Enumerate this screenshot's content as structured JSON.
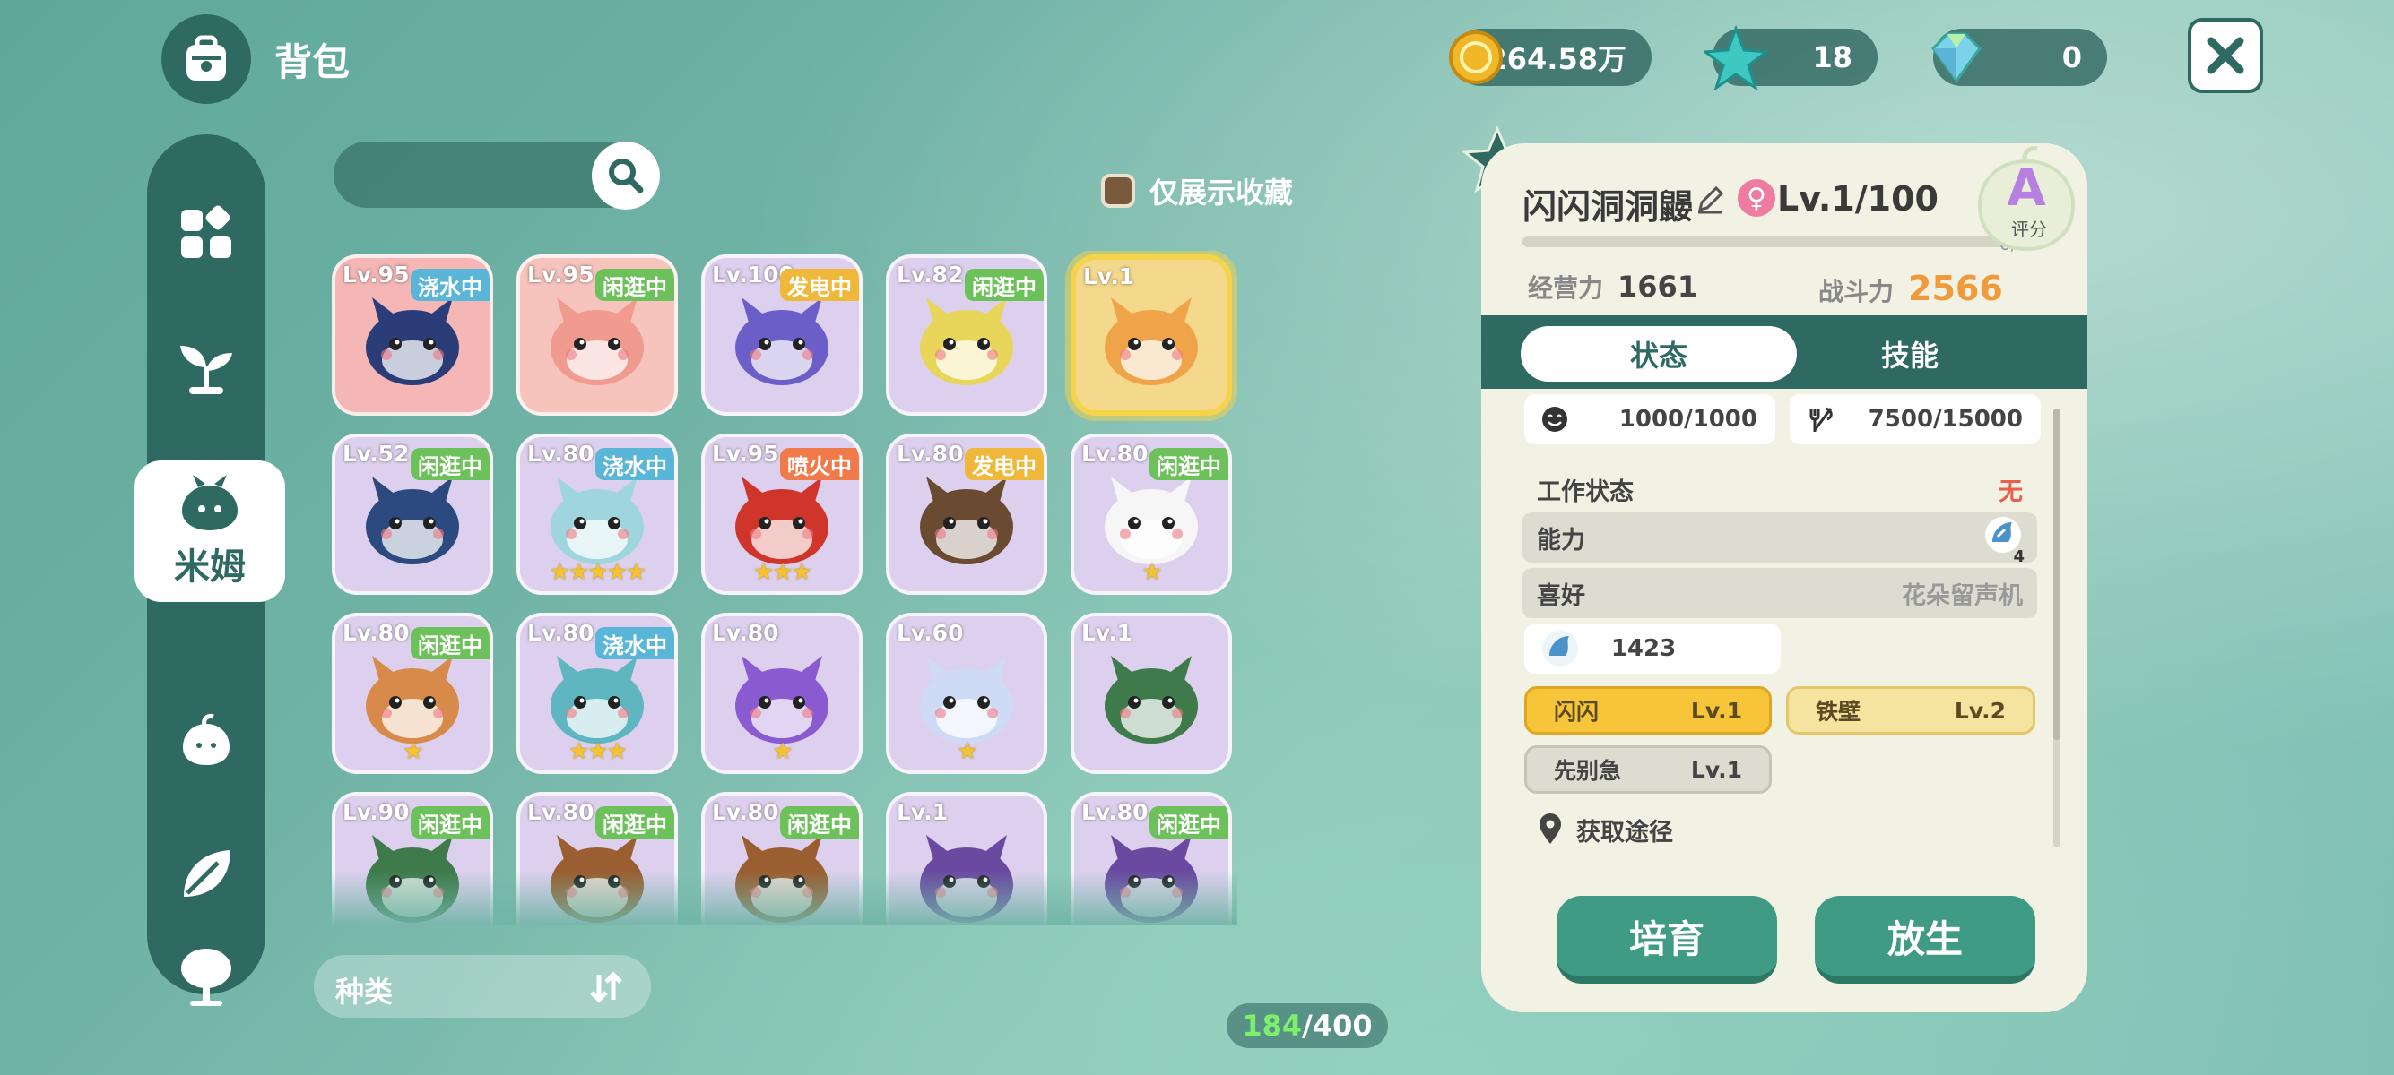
{
  "header": {
    "title": "背包"
  },
  "currencies": [
    {
      "name": "gold-coin",
      "value": "264.58万"
    },
    {
      "name": "star-crystal",
      "value": "18"
    },
    {
      "name": "gem",
      "value": "0"
    }
  ],
  "sidebar": {
    "active_label": "米姆"
  },
  "filter": {
    "favorites_label": "仅展示收藏"
  },
  "sort": {
    "label": "种类"
  },
  "inventory": {
    "count": "184",
    "capacity": "/400"
  },
  "creatures": [
    {
      "lv": "Lv.95",
      "status": "浇水中",
      "stars": ""
    },
    {
      "lv": "Lv.95",
      "status": "闲逛中",
      "stars": ""
    },
    {
      "lv": "Lv.100",
      "status": "发电中",
      "stars": ""
    },
    {
      "lv": "Lv.82",
      "status": "闲逛中",
      "stars": ""
    },
    {
      "lv": "Lv.1",
      "status": "",
      "stars": ""
    },
    {
      "lv": "Lv.52",
      "status": "闲逛中",
      "stars": ""
    },
    {
      "lv": "Lv.80",
      "status": "浇水中",
      "stars": "★★★★★"
    },
    {
      "lv": "Lv.95",
      "status": "喷火中",
      "stars": "★★★"
    },
    {
      "lv": "Lv.80",
      "status": "发电中",
      "stars": ""
    },
    {
      "lv": "Lv.80",
      "status": "闲逛中",
      "stars": "★"
    },
    {
      "lv": "Lv.80",
      "status": "闲逛中",
      "stars": "★"
    },
    {
      "lv": "Lv.80",
      "status": "浇水中",
      "stars": "★★★"
    },
    {
      "lv": "Lv.80",
      "status": "",
      "stars": "★"
    },
    {
      "lv": "Lv.60",
      "status": "",
      "stars": "★"
    },
    {
      "lv": "Lv.1",
      "status": "",
      "stars": ""
    },
    {
      "lv": "Lv.90",
      "status": "闲逛中",
      "stars": ""
    },
    {
      "lv": "Lv.80",
      "status": "闲逛中",
      "stars": ""
    },
    {
      "lv": "Lv.80",
      "status": "闲逛中",
      "stars": ""
    },
    {
      "lv": "Lv.1",
      "status": "",
      "stars": ""
    },
    {
      "lv": "Lv.80",
      "status": "闲逛中",
      "stars": ""
    }
  ],
  "detail": {
    "name": "闪闪洞洞鼹",
    "level": "Lv.1/100",
    "xp": "0/15",
    "rank": "A",
    "rank_label": "评分",
    "management_label": "经营力",
    "management_value": "1661",
    "combat_label": "战斗力",
    "combat_value": "2566",
    "tabs": {
      "status": "状态",
      "skills": "技能"
    },
    "stamina": "1000/1000",
    "food": "7500/15000",
    "work_status_label": "工作状态",
    "work_status_value": "无",
    "ability_label": "能力",
    "ability_level": "4",
    "hobby_label": "喜好",
    "hobby_value": "花朵留声机",
    "ability_power": "1423",
    "skills": [
      {
        "name": "闪闪",
        "lv": "Lv.1"
      },
      {
        "name": "铁壁",
        "lv": "Lv.2"
      },
      {
        "name": "先别急",
        "lv": "Lv.1"
      }
    ],
    "source_label": "获取途径",
    "breed_label": "培育",
    "release_label": "放生"
  },
  "colors": {
    "accent": "#2f6a62",
    "combat": "#f09a3c",
    "warn": "#e8604a",
    "selected": "#f5d34a"
  }
}
